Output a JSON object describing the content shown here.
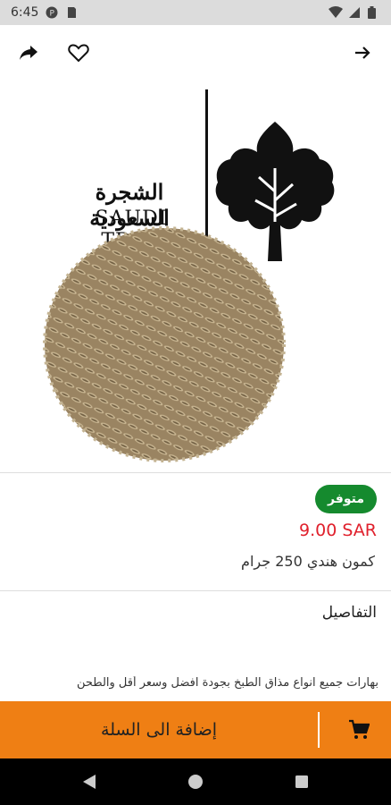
{
  "status_bar": {
    "time": "6:45",
    "icons_left": [
      "notification-p-icon",
      "sd-card-icon"
    ],
    "icons_right": [
      "wifi-icon",
      "signal-icon",
      "battery-icon"
    ]
  },
  "app_bar": {
    "icons": [
      "share-icon",
      "heart-icon",
      "forward-arrow-icon"
    ]
  },
  "hero": {
    "brand_arabic": "الشجرة السعودية",
    "brand_english": "SAUDI TREE"
  },
  "product": {
    "availability": "متوفر",
    "price": "9.00 SAR",
    "name": "كمون هندي 250 جرام"
  },
  "details": {
    "title": "التفاصيل",
    "description": "بهارات جميع انواع مذاق الطبخ بجودة افضل وسعر أقل والطحن"
  },
  "cart": {
    "label": "إضافة الى السلة",
    "icon": "cart-icon"
  },
  "colors": {
    "accent": "#ef7f14",
    "availability_badge": "#158a2e",
    "price": "#e0202c"
  },
  "nav": {
    "icons": [
      "back-triangle-icon",
      "home-circle-icon",
      "recents-square-icon"
    ]
  }
}
